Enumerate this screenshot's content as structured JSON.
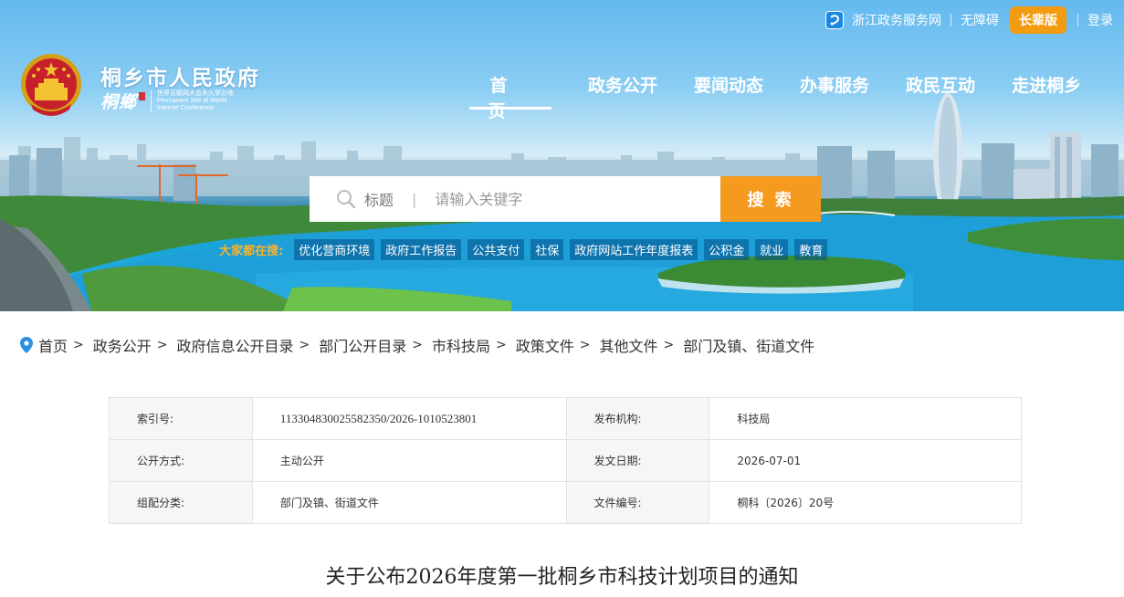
{
  "topbar": {
    "zj_service": "浙江政务服务网",
    "accessibility": "无障碍",
    "elder_mode": "长辈版",
    "login": "登录"
  },
  "site": {
    "title": "桐乡市人民政府",
    "calligraphy": "桐鄉",
    "subtitle_line1": "世界互联网大会永久举办地",
    "subtitle_line2": "Permanent Site of World",
    "subtitle_line3": "Internet Conference"
  },
  "nav": {
    "items": [
      "首页",
      "政务公开",
      "要闻动态",
      "办事服务",
      "政民互动",
      "走进桐乡"
    ],
    "active_index": 0
  },
  "search": {
    "scope": "标题",
    "placeholder": "请输入关键字",
    "button": "搜 索"
  },
  "hot": {
    "label": "大家都在搜:",
    "tags": [
      "优化营商环境",
      "政府工作报告",
      "公共支付",
      "社保",
      "政府网站工作年度报表",
      "公积金",
      "就业",
      "教育"
    ]
  },
  "breadcrumb": [
    "首页",
    "政务公开",
    "政府信息公开目录",
    "部门公开目录",
    "市科技局",
    "政策文件",
    "其他文件",
    "部门及镇、街道文件"
  ],
  "meta": {
    "index_label": "索引号:",
    "index_value": "113304830025582350/2026-1010523801",
    "publisher_label": "发布机构:",
    "publisher_value": "科技局",
    "method_label": "公开方式:",
    "method_value": "主动公开",
    "date_label": "发文日期:",
    "date_value": "2026-07-01",
    "category_label": "组配分类:",
    "category_value": "部门及镇、街道文件",
    "docno_label": "文件编号:",
    "docno_value": "桐科〔2026〕20号"
  },
  "document": {
    "title": "关于公布2026年度第一批桐乡市科技计划项目的通知"
  },
  "colors": {
    "accent_orange": "#f39a1f",
    "sky_blue": "#63b9ef",
    "hot_label": "#f7b52c"
  }
}
